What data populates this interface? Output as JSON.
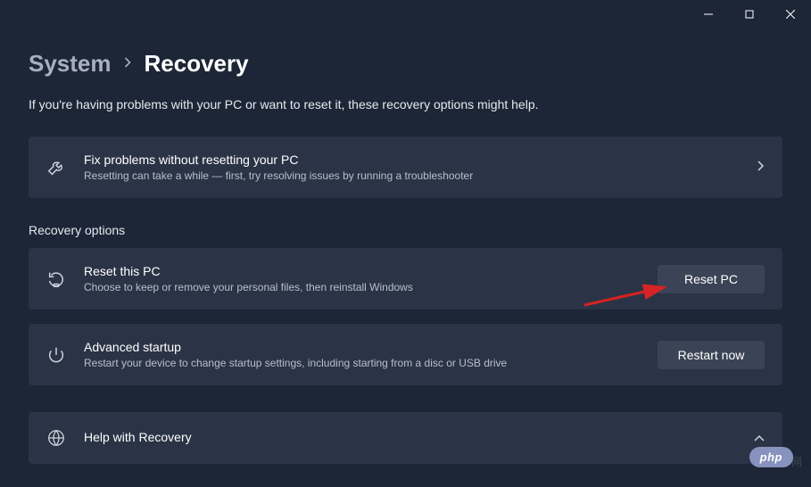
{
  "titlebar": {
    "minimize": "minimize",
    "maximize": "maximize",
    "close": "close"
  },
  "breadcrumb": {
    "parent": "System",
    "current": "Recovery"
  },
  "intro": "If you're having problems with your PC or want to reset it, these recovery options might help.",
  "card_fix": {
    "title": "Fix problems without resetting your PC",
    "sub": "Resetting can take a while — first, try resolving issues by running a troubleshooter"
  },
  "section_header": "Recovery options",
  "card_reset": {
    "title": "Reset this PC",
    "sub": "Choose to keep or remove your personal files, then reinstall Windows",
    "button": "Reset PC"
  },
  "card_advanced": {
    "title": "Advanced startup",
    "sub": "Restart your device to change startup settings, including starting from a disc or USB drive",
    "button": "Restart now"
  },
  "card_help": {
    "title": "Help with Recovery"
  },
  "badge": "php",
  "watermark": "网"
}
